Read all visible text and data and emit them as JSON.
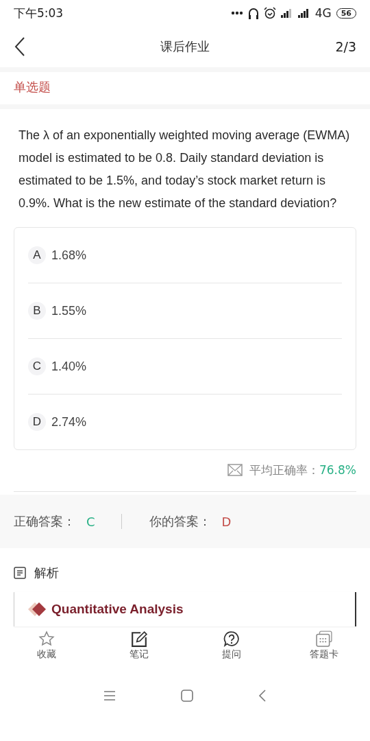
{
  "status_bar": {
    "time": "下午5:03",
    "network": "4G",
    "battery": "56"
  },
  "header": {
    "title": "课后作业",
    "progress": "2/3"
  },
  "question_type": "单选题",
  "question": "The λ of an exponentially weighted moving average (EWMA) model is estimated to be 0.8. Daily standard deviation is estimated to be 1.5%, and today’s stock market return is 0.9%. What is the new estimate of the standard deviation?",
  "options": [
    {
      "letter": "A",
      "text": "1.68%"
    },
    {
      "letter": "B",
      "text": "1.55%"
    },
    {
      "letter": "C",
      "text": "1.40%"
    },
    {
      "letter": "D",
      "text": "2.74%"
    }
  ],
  "accuracy": {
    "label": "平均正确率：",
    "value": "76.8%"
  },
  "answers": {
    "correct_label": "正确答案：",
    "correct": "C",
    "yours_label": "你的答案：",
    "yours": "D"
  },
  "analysis": {
    "title": "解析",
    "heading": "Quantitative Analysis"
  },
  "bottom_tabs": [
    {
      "kind": "star",
      "label": "收藏"
    },
    {
      "kind": "note",
      "label": "笔记"
    },
    {
      "kind": "ask",
      "label": "提问"
    },
    {
      "kind": "card",
      "label": "答题卡"
    }
  ]
}
